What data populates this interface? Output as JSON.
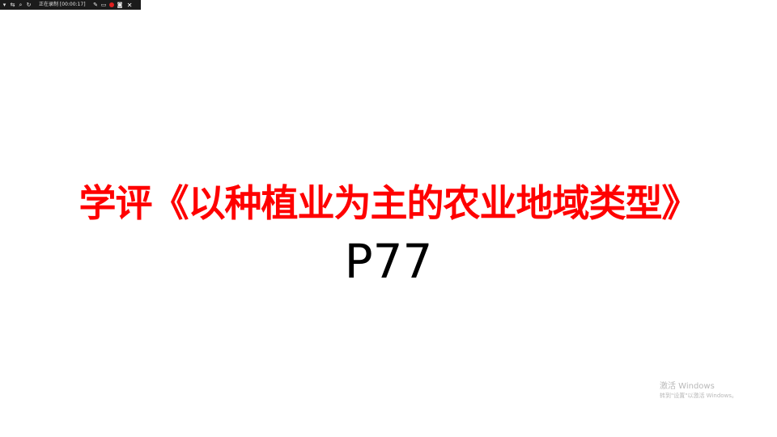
{
  "toolbar": {
    "status": "正在录制 [00:00:17]",
    "icons": [
      "dropdown-icon",
      "camera-switch-icon",
      "zoom-icon",
      "refresh-icon",
      "pen-icon",
      "screen-icon",
      "record-icon",
      "snapshot-icon",
      "close-icon"
    ],
    "record_color": "#e02020"
  },
  "slide": {
    "title": "学评《以种植业为主的农业地域类型》",
    "subtitle": "P77",
    "title_color": "#ff0000",
    "subtitle_color": "#000000"
  },
  "watermark": {
    "title": "激活 Windows",
    "subtitle": "转到\"设置\"以激活 Windows。"
  }
}
